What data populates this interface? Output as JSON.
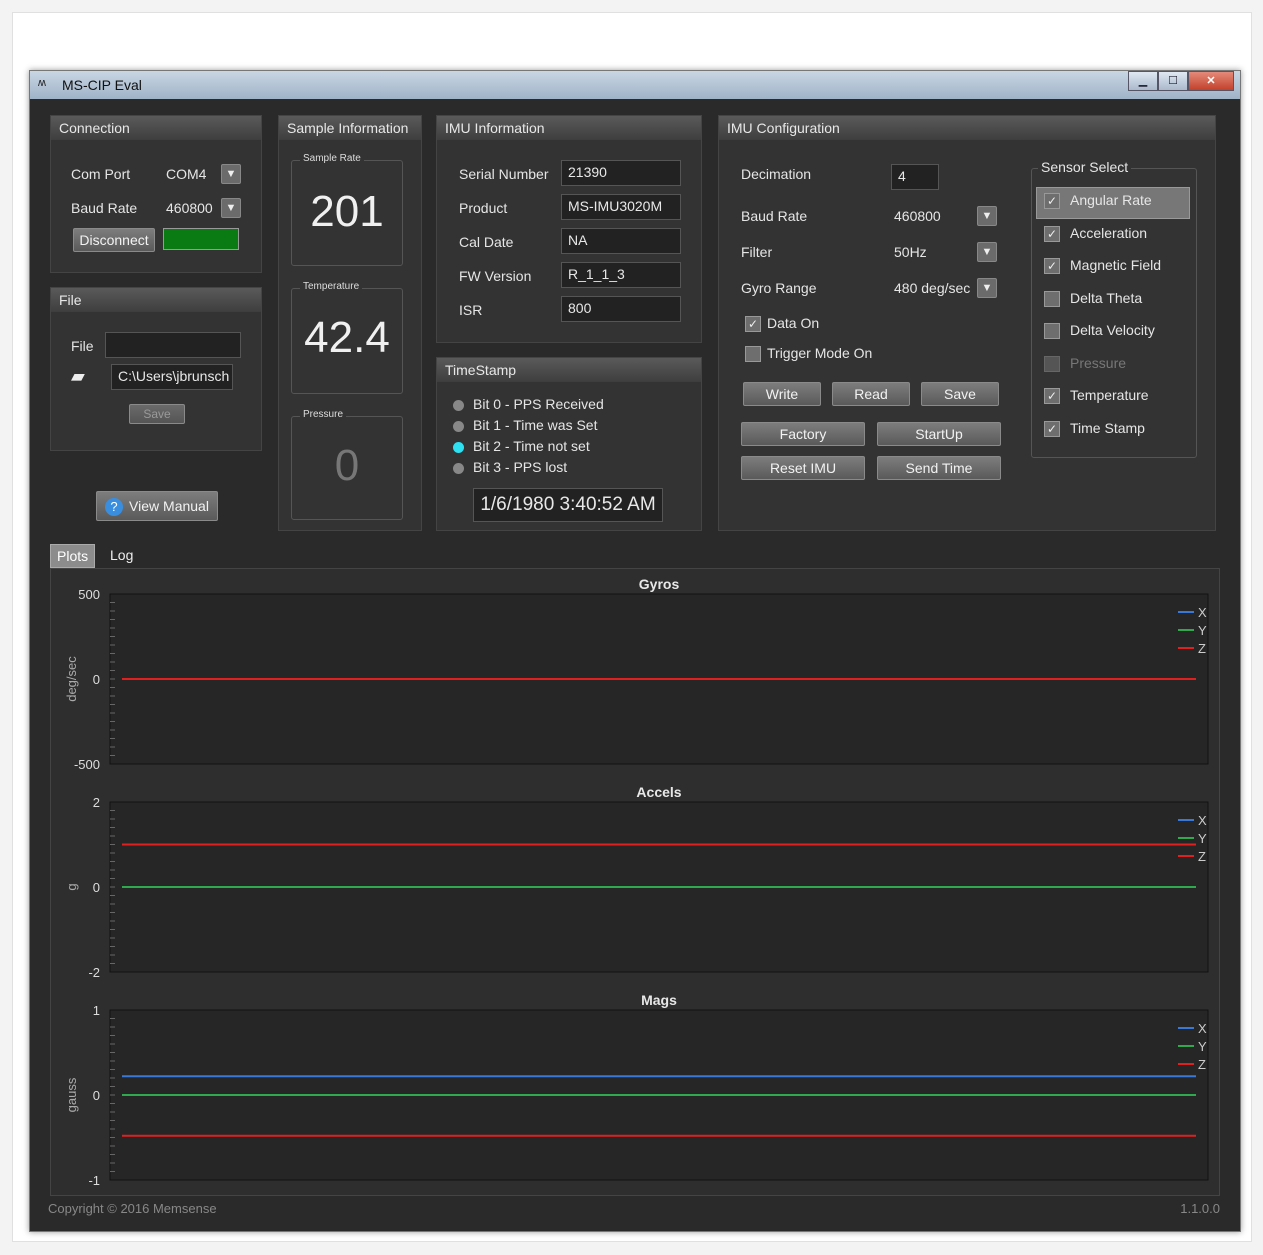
{
  "window": {
    "title": "MS-CIP Eval",
    "app_icon": "memsense-logo-icon"
  },
  "connection": {
    "title": "Connection",
    "com_port_label": "Com Port",
    "com_port_value": "COM4",
    "baud_rate_label": "Baud Rate",
    "baud_rate_value": "460800",
    "disconnect_label": "Disconnect",
    "status_color": "#0a7a12"
  },
  "file": {
    "title": "File",
    "file_label": "File",
    "file_value": "",
    "path_value": "C:\\Users\\jbrunsch",
    "save_label": "Save"
  },
  "view_manual_label": "View Manual",
  "sample_info": {
    "title": "Sample Information",
    "sample_rate_caption": "Sample Rate",
    "sample_rate_value": "201",
    "temperature_caption": "Temperature",
    "temperature_value": "42.4",
    "pressure_caption": "Pressure",
    "pressure_value": "0"
  },
  "imu_info": {
    "title": "IMU Information",
    "rows": [
      {
        "label": "Serial Number",
        "value": "21390"
      },
      {
        "label": "Product",
        "value": "MS-IMU3020M"
      },
      {
        "label": "Cal Date",
        "value": "NA"
      },
      {
        "label": "FW Version",
        "value": "R_1_1_3"
      },
      {
        "label": "ISR",
        "value": "800"
      }
    ]
  },
  "timestamp": {
    "title": "TimeStamp",
    "bits": [
      {
        "label": "Bit 0 - PPS Received",
        "active": false
      },
      {
        "label": "Bit 1 - Time was Set",
        "active": false
      },
      {
        "label": "Bit 2 - Time not set",
        "active": true
      },
      {
        "label": "Bit 3 - PPS lost",
        "active": false
      }
    ],
    "value": "1/6/1980 3:40:52 AM"
  },
  "imu_config": {
    "title": "IMU Configuration",
    "decimation_label": "Decimation",
    "decimation_value": "4",
    "baud_rate_label": "Baud Rate",
    "baud_rate_value": "460800",
    "filter_label": "Filter",
    "filter_value": "50Hz",
    "gyro_range_label": "Gyro Range",
    "gyro_range_value": "480 deg/sec",
    "data_on_label": "Data On",
    "data_on_checked": true,
    "trigger_mode_label": "Trigger Mode On",
    "trigger_mode_checked": false,
    "write_label": "Write",
    "read_label": "Read",
    "save_label": "Save",
    "factory_label": "Factory",
    "startup_label": "StartUp",
    "reset_label": "Reset IMU",
    "send_time_label": "Send Time"
  },
  "sensor_select": {
    "title": "Sensor Select",
    "items": [
      {
        "label": "Angular Rate",
        "checked": true,
        "enabled": true
      },
      {
        "label": "Acceleration",
        "checked": true,
        "enabled": true
      },
      {
        "label": "Magnetic Field",
        "checked": true,
        "enabled": true
      },
      {
        "label": "Delta Theta",
        "checked": false,
        "enabled": true
      },
      {
        "label": "Delta Velocity",
        "checked": false,
        "enabled": true
      },
      {
        "label": "Pressure",
        "checked": false,
        "enabled": false
      },
      {
        "label": "Temperature",
        "checked": true,
        "enabled": true
      },
      {
        "label": "Time Stamp",
        "checked": true,
        "enabled": true
      }
    ]
  },
  "tabs": {
    "plots": "Plots",
    "log": "Log"
  },
  "footer": {
    "copyright": "Copyright © 2016 Memsense",
    "version": "1.1.0.0"
  },
  "colors": {
    "x": "#3a78d8",
    "y": "#2fa84f",
    "z": "#e02020"
  },
  "chart_data": [
    {
      "type": "line",
      "title": "Gyros",
      "ylabel": "deg/sec",
      "ylim": [
        -500,
        500
      ],
      "yticks": [
        "500",
        "0",
        "-500"
      ],
      "series": [
        {
          "name": "X",
          "values": [
            0,
            0
          ]
        },
        {
          "name": "Y",
          "values": [
            0,
            0
          ]
        },
        {
          "name": "Z",
          "values": [
            0,
            0
          ]
        }
      ],
      "legend": "top-right"
    },
    {
      "type": "line",
      "title": "Accels",
      "ylabel": "g",
      "ylim": [
        -2,
        2
      ],
      "yticks": [
        "2",
        "0",
        "-2"
      ],
      "series": [
        {
          "name": "X",
          "values": [
            0,
            0
          ]
        },
        {
          "name": "Y",
          "values": [
            0,
            0
          ]
        },
        {
          "name": "Z",
          "values": [
            1,
            1
          ]
        }
      ],
      "legend": "top-right"
    },
    {
      "type": "line",
      "title": "Mags",
      "ylabel": "gauss",
      "ylim": [
        -1,
        1
      ],
      "yticks": [
        "1",
        "0",
        "-1"
      ],
      "series": [
        {
          "name": "X",
          "values": [
            0.22,
            0.22
          ]
        },
        {
          "name": "Y",
          "values": [
            0,
            0
          ]
        },
        {
          "name": "Z",
          "values": [
            -0.48,
            -0.48
          ]
        }
      ],
      "legend": "top-right"
    }
  ]
}
